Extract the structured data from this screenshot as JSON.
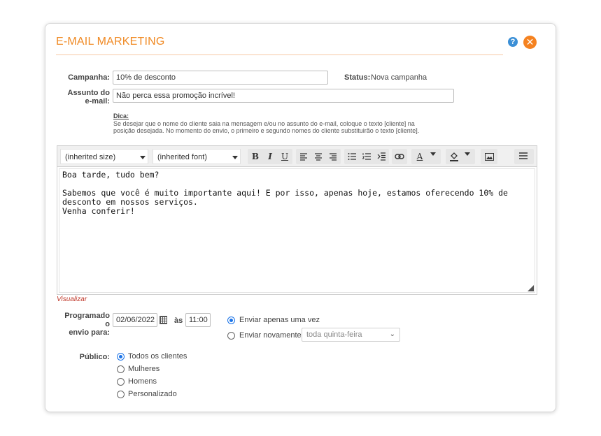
{
  "dialog": {
    "title": "E-MAIL MARKETING",
    "help_icon_glyph": "?",
    "close_icon_glyph": "✕"
  },
  "campaign": {
    "label": "Campanha:",
    "value": "10% de desconto",
    "status_label": "Status:",
    "status_value": "Nova campanha"
  },
  "subject": {
    "label_line1": "Assunto do",
    "label_line2": "e-mail:",
    "value": "Não perca essa promoção incrível!"
  },
  "hint": {
    "title": "Dica:",
    "text": "Se desejar que o nome do cliente saia na mensagem e/ou no assunto do e-mail, coloque o texto [cliente] na posição desejada. No momento do envio, o primeiro e segundo nomes do cliente substituirão o texto [cliente]."
  },
  "editor": {
    "size_select": "(inherited size)",
    "font_select": "(inherited font)",
    "bold": "B",
    "italic": "I",
    "underline": "U",
    "text_color_glyph": "A",
    "body": "Boa tarde, tudo bem?\n\nSabemos que você é muito importante aqui! E por isso, apenas hoje, estamos oferecendo 10% de desconto em nossos serviços.\nVenha conferir!"
  },
  "preview_link": "Visualizar",
  "schedule": {
    "label_line1": "Programado o",
    "label_line2": "envio para:",
    "date": "02/06/2022",
    "at_label": "às",
    "time": "11:00",
    "option_once": "Enviar apenas uma vez",
    "option_repeat": "Enviar novamente",
    "repeat_select": "toda quinta-feira",
    "selected": "once"
  },
  "audience": {
    "label": "Público:",
    "options": [
      "Todos os clientes",
      "Mulheres",
      "Homens",
      "Personalizado"
    ],
    "selected": "Todos os clientes"
  },
  "colors": {
    "accent": "#f08a24",
    "close_button": "#f58220",
    "help_icon": "#3b8fd6",
    "radio_selected": "#1a73e8",
    "preview_link": "#c0392b"
  }
}
